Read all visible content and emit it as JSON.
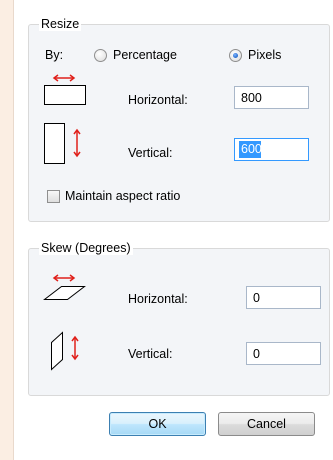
{
  "resize": {
    "title": "Resize",
    "by_label": "By:",
    "percentage_label": "Percentage",
    "pixels_label": "Pixels",
    "selected_mode": "Pixels",
    "horizontal_label": "Horizontal:",
    "horizontal_value": "800",
    "vertical_label": "Vertical:",
    "vertical_value": "600",
    "maintain_label": "Maintain aspect ratio",
    "maintain_checked": false
  },
  "skew": {
    "title": "Skew (Degrees)",
    "horizontal_label": "Horizontal:",
    "horizontal_value": "0",
    "vertical_label": "Vertical:",
    "vertical_value": "0"
  },
  "buttons": {
    "ok": "OK",
    "cancel": "Cancel"
  },
  "colors": {
    "arrow": "#e0201a",
    "selection": "#3399ff",
    "default_button_border": "#3c7fb1"
  },
  "icons": [
    "resize-horizontal-icon",
    "resize-vertical-icon",
    "skew-horizontal-icon",
    "skew-vertical-icon"
  ]
}
